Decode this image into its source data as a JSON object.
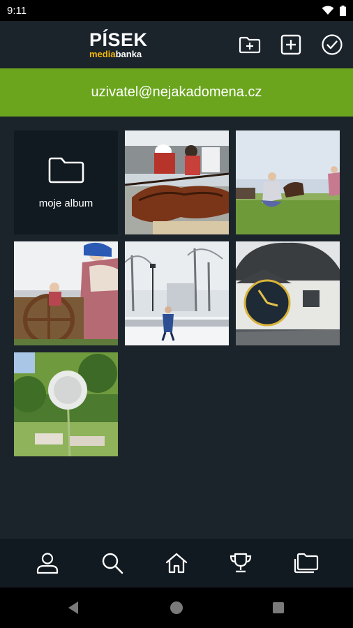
{
  "status_bar": {
    "time": "9:11"
  },
  "header": {
    "logo_title": "PÍSEK",
    "logo_sub_accent": "media",
    "logo_sub_rest": "banka",
    "actions": [
      {
        "name": "add-album-button",
        "icon": "folder-plus-icon"
      },
      {
        "name": "add-photo-button",
        "icon": "plus-square-icon"
      },
      {
        "name": "select-button",
        "icon": "check-circle-icon"
      }
    ]
  },
  "user": {
    "email": "uzivatel@nejakadomena.cz"
  },
  "album": {
    "label": "moje album"
  },
  "bottom_nav": [
    "user-icon",
    "search-icon",
    "home-icon",
    "trophy-icon",
    "folders-icon"
  ],
  "colors": {
    "accent_green": "#6aa51d",
    "background": "#1b232b",
    "logo_accent": "#f2b705"
  }
}
